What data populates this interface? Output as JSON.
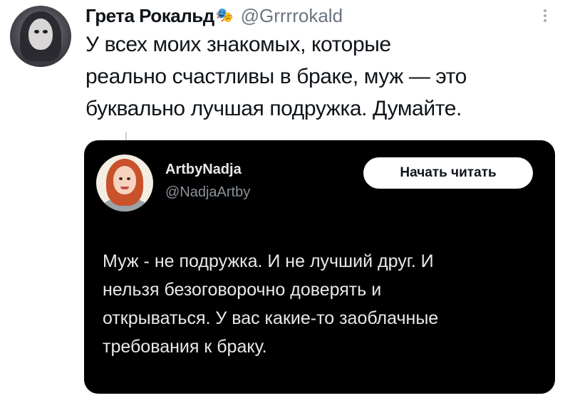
{
  "tweet": {
    "author_name": "Грета Рокальд",
    "author_badge_icon": "performing-arts-icon",
    "author_handle": "@Grrrrokald",
    "text_lines": [
      "У всех моих знакомых, которые",
      "реально счастливы в браке, муж — это",
      "буквально лучшая подружка. Думайте."
    ]
  },
  "quoted_card": {
    "author_name": "ArtbyNadja",
    "author_handle": "@NadjaArtby",
    "button_label": "Начать читать",
    "text_lines": [
      "Муж - не подружка. И не лучший друг. И",
      "нельзя безоговорочно доверять и",
      "открываться. У вас  какие-то  заоблачные",
      "требования к браку."
    ]
  },
  "colors": {
    "card_background": "#000000",
    "handle_gray": "#6b7580",
    "text_dark": "#0f1419"
  }
}
